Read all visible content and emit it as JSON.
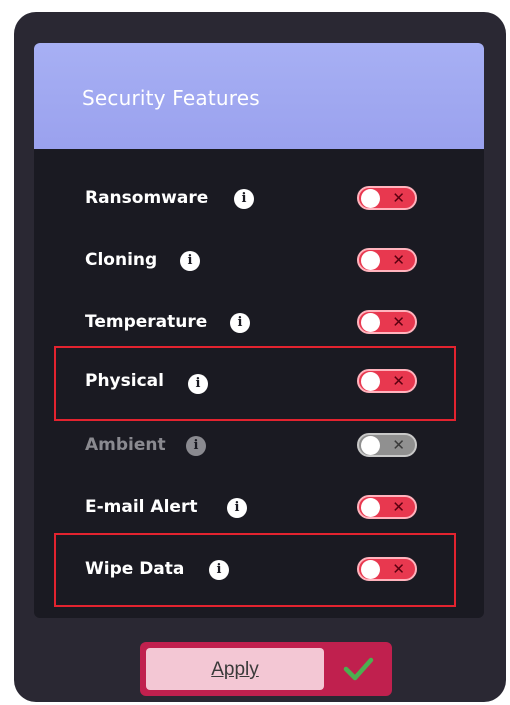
{
  "panel": {
    "title": "Security Features"
  },
  "features": [
    {
      "label": "Ransomware",
      "enabled": false,
      "disabled": false,
      "highlighted": false,
      "info_icon": "info-icon",
      "toggle_symbol": "✕"
    },
    {
      "label": "Cloning",
      "enabled": false,
      "disabled": false,
      "highlighted": false,
      "info_icon": "info-icon",
      "toggle_symbol": "✕"
    },
    {
      "label": "Temperature",
      "enabled": false,
      "disabled": false,
      "highlighted": false,
      "info_icon": "info-icon",
      "toggle_symbol": "✕"
    },
    {
      "label": "Physical",
      "enabled": false,
      "disabled": false,
      "highlighted": true,
      "info_icon": "info-icon",
      "toggle_symbol": "✕"
    },
    {
      "label": "Ambient",
      "enabled": false,
      "disabled": true,
      "highlighted": false,
      "info_icon": "info-icon",
      "toggle_symbol": "✕"
    },
    {
      "label": "E-mail Alert",
      "enabled": false,
      "disabled": false,
      "highlighted": false,
      "info_icon": "info-icon",
      "toggle_symbol": "✕"
    },
    {
      "label": "Wipe Data",
      "enabled": false,
      "disabled": false,
      "highlighted": true,
      "info_icon": "info-icon",
      "toggle_symbol": "✕"
    }
  ],
  "info_glyph": "i",
  "apply": {
    "label": "Apply",
    "icon": "checkmark-icon"
  },
  "colors": {
    "header": "#a7b0f4",
    "toggle_off": "#e8384f",
    "highlight": "#e3232f",
    "apply_accent": "#c0204e",
    "check": "#4caf50"
  }
}
